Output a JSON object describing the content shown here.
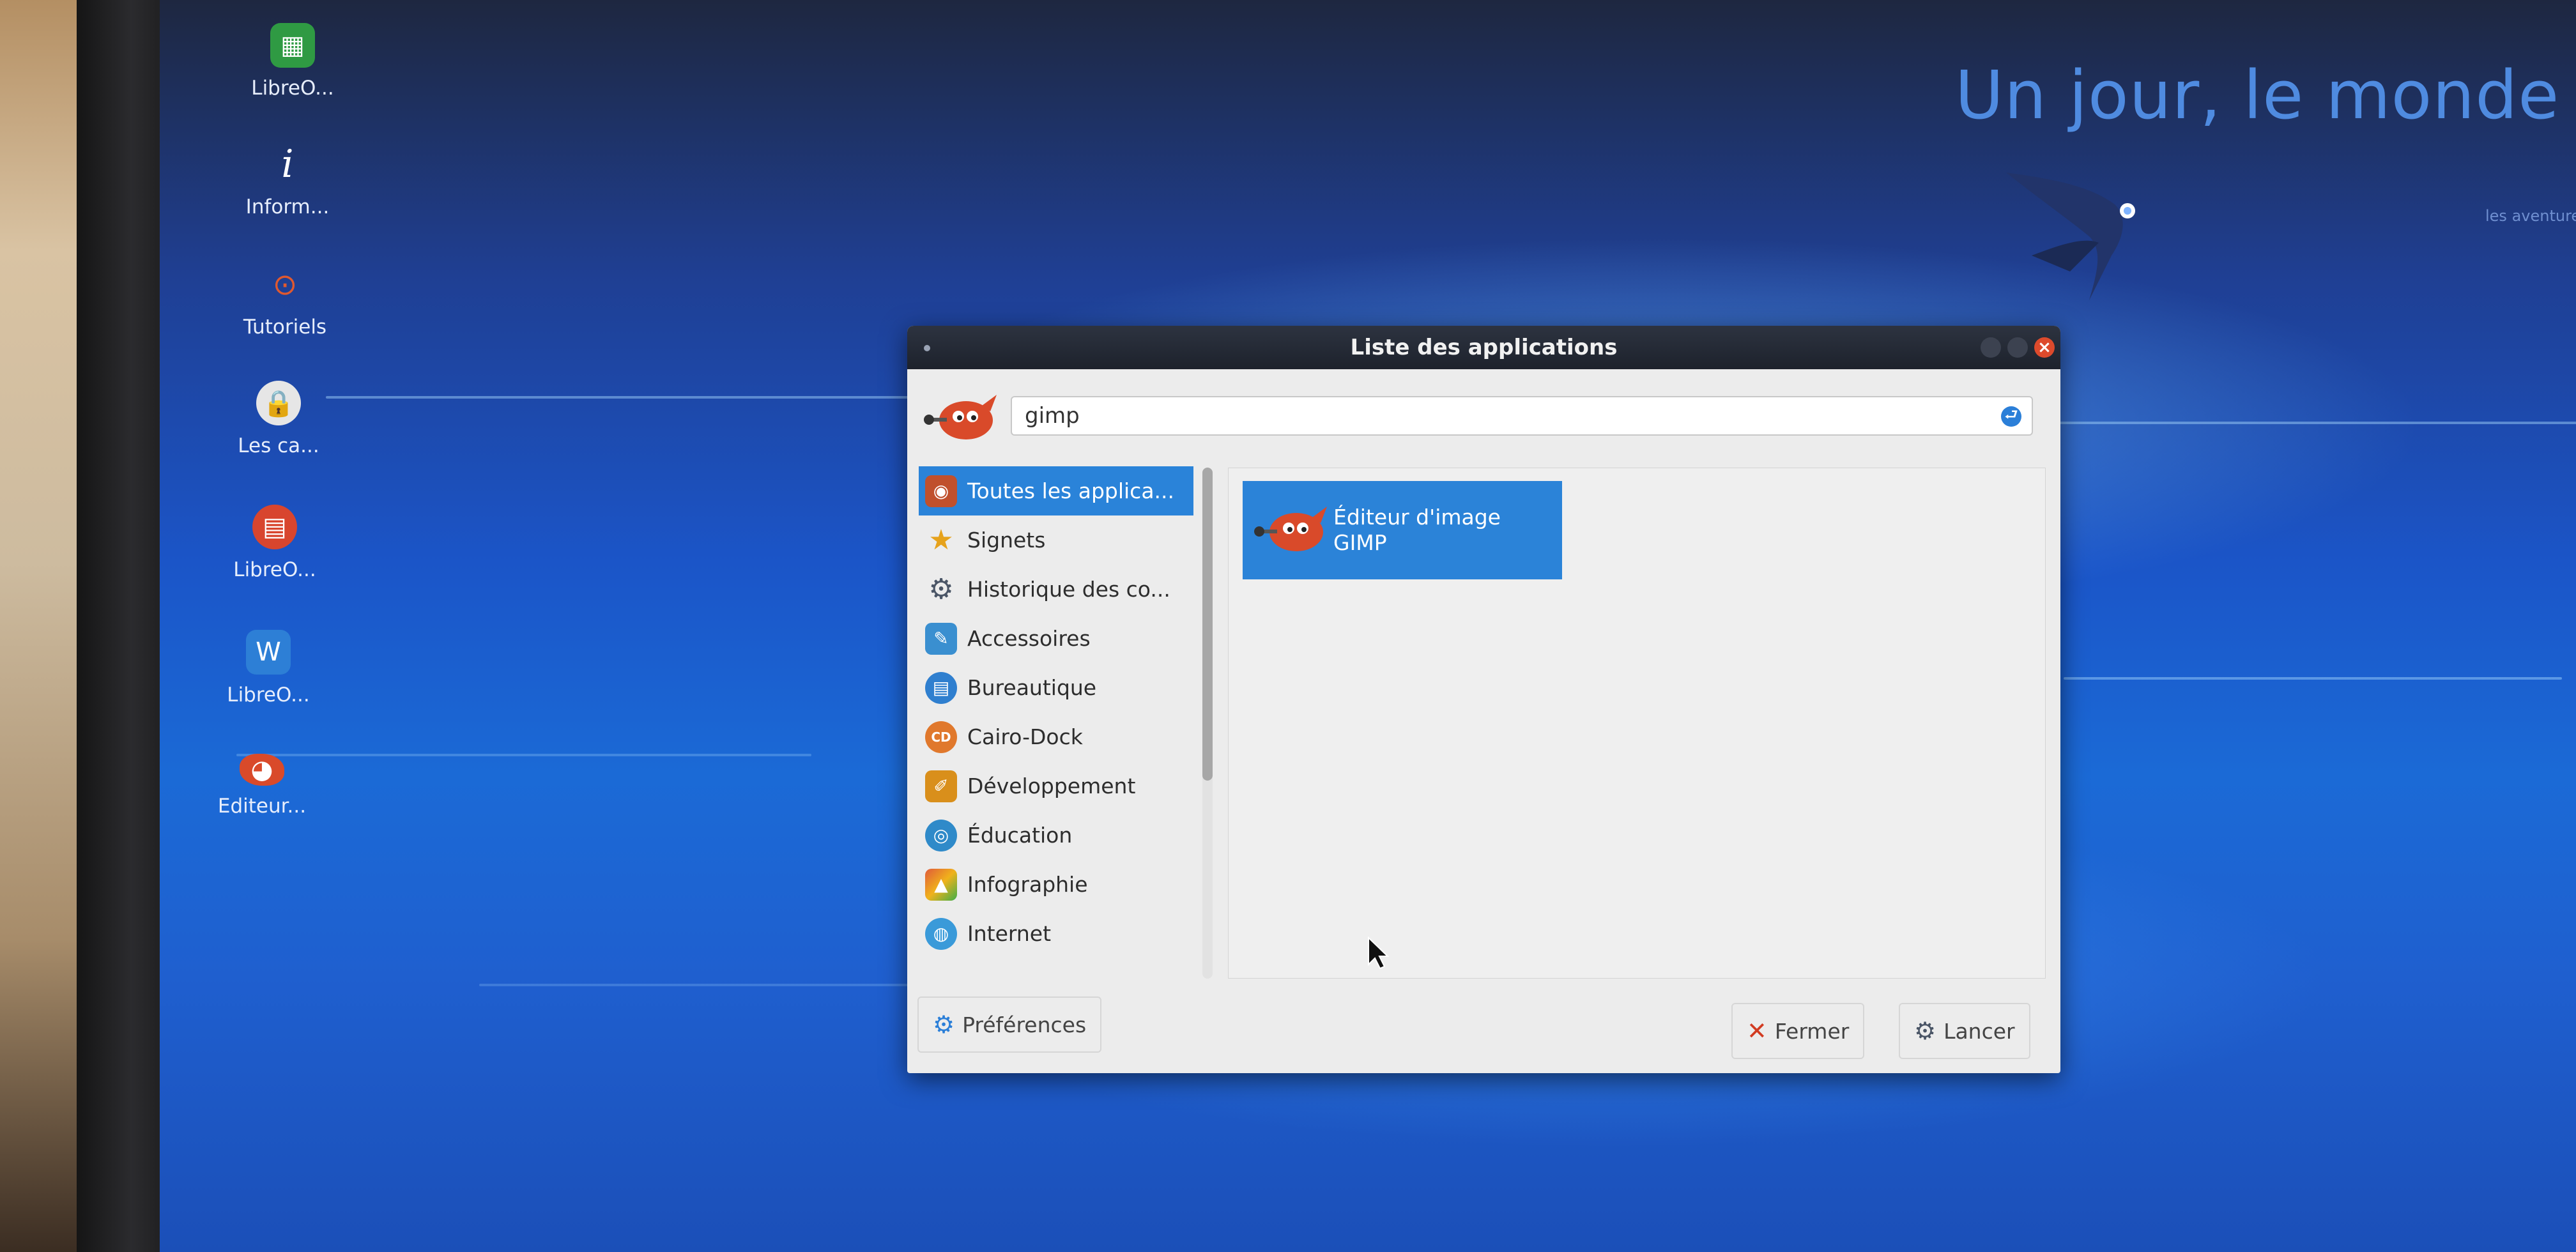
{
  "wallpaper": {
    "title": "Un jour, le monde sera",
    "subtitle": "soft",
    "tagline": "les aventures d'un peuple"
  },
  "desktop_icons": [
    {
      "label": "LibreO...",
      "icon": "libreoffice-calc-icon",
      "color": "#2f9a43"
    },
    {
      "label": "Inform...",
      "icon": "info-icon",
      "color": ""
    },
    {
      "label": "Tutoriels",
      "icon": "ubuntu-logo-icon",
      "color": "#e0592f"
    },
    {
      "label": "Les ca...",
      "icon": "lock-icon",
      "color": "#d9d9d9"
    },
    {
      "label": "LibreO...",
      "icon": "libreoffice-impress-icon",
      "color": "#d8452e"
    },
    {
      "label": "LibreO...",
      "icon": "libreoffice-writer-icon",
      "color": "#2d7fd6"
    },
    {
      "label": "Editeur...",
      "icon": "gimp-icon",
      "color": "#d94a2a"
    }
  ],
  "dialog": {
    "title": "Liste des applications",
    "search_value": "gimp",
    "categories": [
      {
        "label": "Toutes les applica...",
        "icon": "all-applications-icon",
        "color": "#c0502c",
        "selected": true
      },
      {
        "label": "Signets",
        "icon": "star-icon",
        "color": "#e6a21b",
        "selected": false
      },
      {
        "label": "Historique des co...",
        "icon": "history-gears-icon",
        "color": "#4a5566",
        "selected": false
      },
      {
        "label": "Accessoires",
        "icon": "accessories-icon",
        "color": "#3a8fd0",
        "selected": false
      },
      {
        "label": "Bureautique",
        "icon": "office-icon",
        "color": "#2f7fcf",
        "selected": false
      },
      {
        "label": "Cairo-Dock",
        "icon": "cairo-dock-icon",
        "color": "#e0782c",
        "selected": false
      },
      {
        "label": "Développement",
        "icon": "development-icon",
        "color": "#d98f1b",
        "selected": false
      },
      {
        "label": "Éducation",
        "icon": "education-icon",
        "color": "#2f8ac9",
        "selected": false
      },
      {
        "label": "Infographie",
        "icon": "graphics-icon",
        "color": "#e05a3a",
        "selected": false
      },
      {
        "label": "Internet",
        "icon": "internet-globe-icon",
        "color": "#3a9ad9",
        "selected": false
      }
    ],
    "results": [
      {
        "line1": "Éditeur d'image",
        "line2": "GIMP",
        "icon": "gimp-icon"
      }
    ],
    "buttons": {
      "preferences": "Préférences",
      "close": "Fermer",
      "launch": "Lancer"
    }
  }
}
